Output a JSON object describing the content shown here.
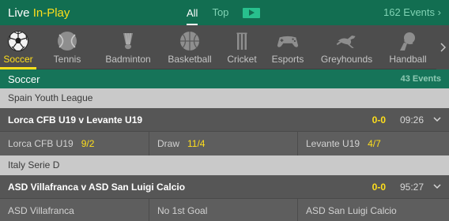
{
  "header": {
    "title_prefix": "Live ",
    "title_accent": "In-Play",
    "tab_all": "All",
    "tab_top": "Top",
    "events_count": "162 Events",
    "events_arrow": "›"
  },
  "sports": [
    {
      "label": "Soccer",
      "icon": "soccer-ball-icon",
      "active": true
    },
    {
      "label": "Tennis",
      "icon": "tennis-ball-icon"
    },
    {
      "label": "Badminton",
      "icon": "shuttlecock-icon"
    },
    {
      "label": "Basketball",
      "icon": "basketball-icon"
    },
    {
      "label": "Cricket",
      "icon": "cricket-icon"
    },
    {
      "label": "Esports",
      "icon": "gamepad-icon"
    },
    {
      "label": "Greyhounds",
      "icon": "greyhound-icon"
    },
    {
      "label": "Handball",
      "icon": "handball-icon"
    }
  ],
  "section": {
    "name": "Soccer",
    "count": "43 Events"
  },
  "leagues": [
    {
      "name": "Spain Youth League",
      "event": {
        "title": "Lorca CFB U19 v Levante U19",
        "score": "0-0",
        "time": "09:26",
        "odds": [
          {
            "label": "Lorca CFB U19",
            "price": "9/2"
          },
          {
            "label": "Draw",
            "price": "11/4"
          },
          {
            "label": "Levante U19",
            "price": "4/7"
          }
        ]
      }
    },
    {
      "name": "Italy Serie D",
      "event": {
        "title": "ASD Villafranca v ASD San Luigi Calcio",
        "score": "0-0",
        "time": "95:27",
        "odds": [
          {
            "label": "ASD Villafranca",
            "price": ""
          },
          {
            "label": "No 1st Goal",
            "price": ""
          },
          {
            "label": "ASD San Luigi Calcio",
            "price": ""
          }
        ]
      }
    }
  ],
  "colors": {
    "brand_green": "#126e51",
    "accent_yellow": "#ffdf1b"
  }
}
